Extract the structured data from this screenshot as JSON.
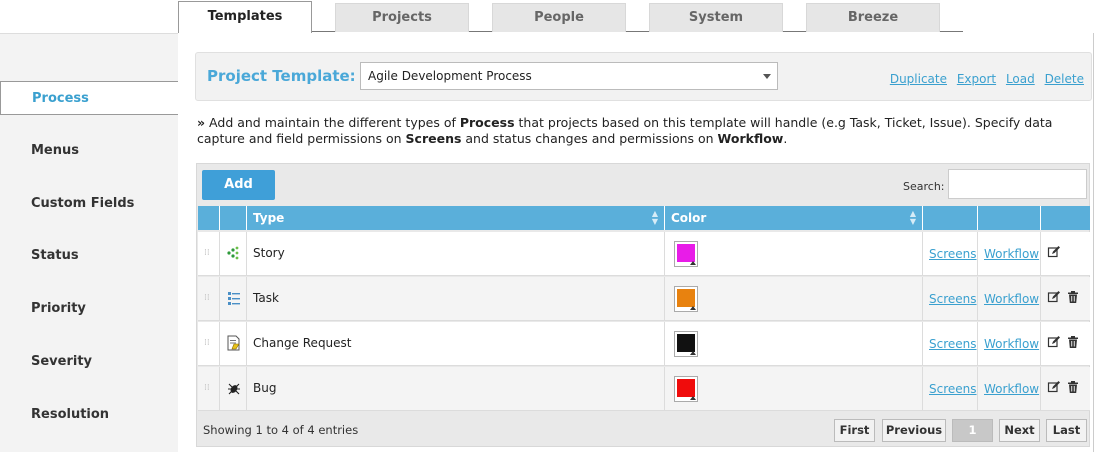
{
  "tabs": [
    {
      "label": "Templates",
      "active": true
    },
    {
      "label": "Projects",
      "active": false
    },
    {
      "label": "People",
      "active": false
    },
    {
      "label": "System",
      "active": false
    },
    {
      "label": "Breeze",
      "active": false
    }
  ],
  "sidebar": {
    "items": [
      {
        "label": "Process",
        "active": true
      },
      {
        "label": "Menus",
        "active": false
      },
      {
        "label": "Custom Fields",
        "active": false
      },
      {
        "label": "Status",
        "active": false
      },
      {
        "label": "Priority",
        "active": false
      },
      {
        "label": "Severity",
        "active": false
      },
      {
        "label": "Resolution",
        "active": false
      }
    ]
  },
  "template_bar": {
    "label": "Project Template:",
    "selected": "Agile Development Process",
    "links": [
      "Duplicate",
      "Export",
      "Load",
      "Delete"
    ]
  },
  "description": {
    "prefix": "»",
    "text1": " Add and maintain the different types of ",
    "bold1": "Process",
    "text2": " that projects based on this template will handle (e.g Task, Ticket, Issue). Specify data capture and field permissions on ",
    "bold2": "Screens",
    "text3": " and status changes and permissions on ",
    "bold3": "Workflow",
    "text4": "."
  },
  "table": {
    "add_label": "Add",
    "search_label": "Search:",
    "search_value": "",
    "columns": {
      "type": "Type",
      "color": "Color"
    },
    "rows": [
      {
        "type": "Story",
        "icon": "story-icon",
        "color": "#e81ce8",
        "screens": "Screens",
        "workflow": "Workflow",
        "deletable": false
      },
      {
        "type": "Task",
        "icon": "task-icon",
        "color": "#e8820f",
        "screens": "Screens",
        "workflow": "Workflow",
        "deletable": true
      },
      {
        "type": "Change Request",
        "icon": "change-request-icon",
        "color": "#111111",
        "screens": "Screens",
        "workflow": "Workflow",
        "deletable": true
      },
      {
        "type": "Bug",
        "icon": "bug-icon",
        "color": "#f00c0c",
        "screens": "Screens",
        "workflow": "Workflow",
        "deletable": true
      }
    ],
    "info": "Showing 1 to 4 of 4 entries",
    "pager": {
      "first": "First",
      "previous": "Previous",
      "current": "1",
      "next": "Next",
      "last": "Last"
    }
  }
}
